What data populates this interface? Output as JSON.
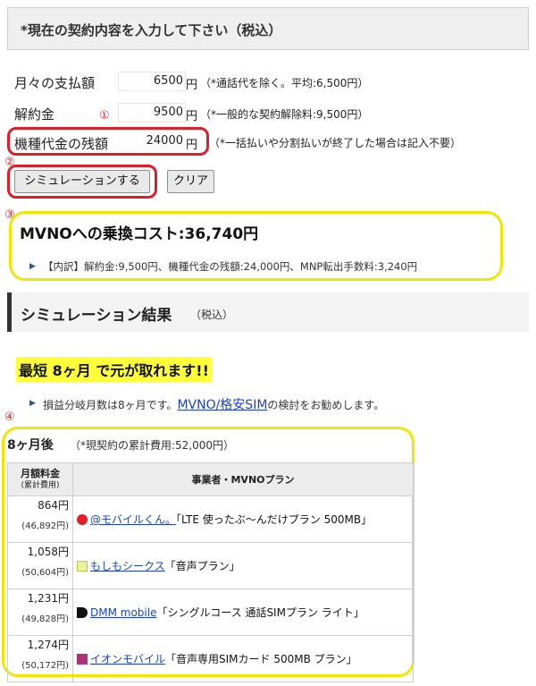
{
  "header": {
    "title": "*現在の契約内容を入力して下さい（税込）"
  },
  "form": {
    "monthly": {
      "label": "月々の支払額",
      "value": "6500",
      "unit": "円",
      "note": "（*通話代を除く。平均:6,500円）"
    },
    "cancel": {
      "label": "解約金",
      "value": "9500",
      "unit": "円",
      "note": "（*一般的な契約解除料:9,500円）"
    },
    "device": {
      "label": "機種代金の残額",
      "value": "24000",
      "unit": "円",
      "note": "（*一括払いや分割払いが終了した場合は記入不要）"
    }
  },
  "buttons": {
    "simulate": "シミュレーションする",
    "clear": "クリア"
  },
  "markers": {
    "m1": "①",
    "m2": "②",
    "m3": "③",
    "m4": "④"
  },
  "cost": {
    "title": "MVNOへの乗換コスト:36,740円",
    "detail": "【内訳】解約金:9,500円、機種代金の残額:24,000円、MNP転出手数料:3,240円"
  },
  "result": {
    "title": "シミュレーション結果",
    "tax": "（税込）",
    "headline": "最短 8ヶ月 で元が取れます!!",
    "message_pre": "損益分岐月数は8ヶ月です。",
    "message_link": "MVNO/格安SIM",
    "message_post": "の検討をお勧めします。",
    "period": "8ヶ月後",
    "period_note": "（*現契約の累計費用:52,000円）"
  },
  "table": {
    "col1_line1": "月額料金",
    "col1_line2": "(累計費用)",
    "col2": "事業者・MVNOプラン",
    "rows": [
      {
        "price": "864円",
        "cumulative": "(46,892円)",
        "provider": "@モバイルくん。",
        "plan": "「LTE 使ったぶ〜んだけプラン 500MB」",
        "icon": "at-mobile-icon"
      },
      {
        "price": "1,058円",
        "cumulative": "(50,604円)",
        "provider": "もしもシークス",
        "plan": "「音声プラン」",
        "icon": "moshimo-icon"
      },
      {
        "price": "1,231円",
        "cumulative": "(49,828円)",
        "provider": "DMM mobile",
        "plan": "「シングルコース 通話SIMプラン ライト」",
        "icon": "dmm-icon"
      },
      {
        "price": "1,274円",
        "cumulative": "(50,172円)",
        "provider": "イオンモバイル",
        "plan": "「音声専用SIMカード 500MB プラン」",
        "icon": "aeon-icon"
      }
    ]
  }
}
